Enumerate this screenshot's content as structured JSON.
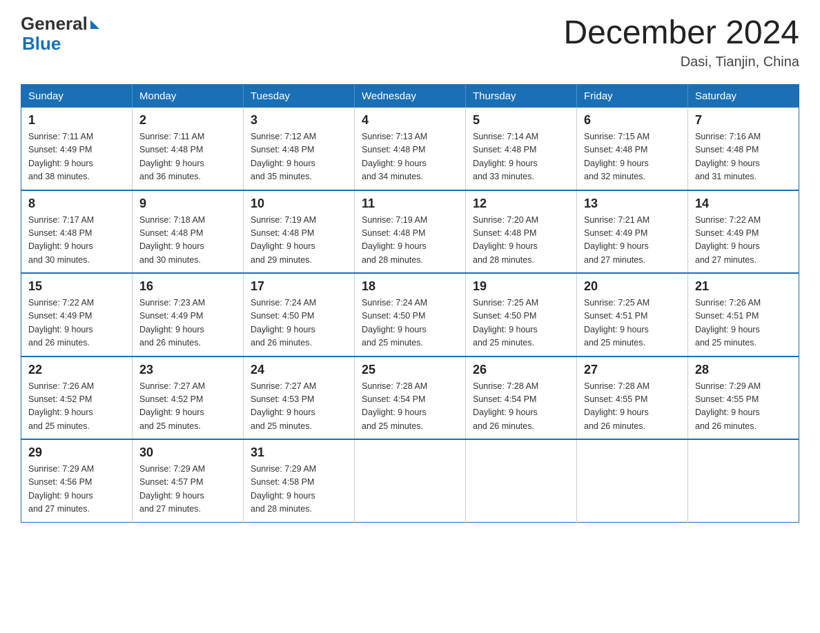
{
  "logo": {
    "text_general": "General",
    "text_blue": "Blue"
  },
  "title": "December 2024",
  "location": "Dasi, Tianjin, China",
  "days_of_week": [
    "Sunday",
    "Monday",
    "Tuesday",
    "Wednesday",
    "Thursday",
    "Friday",
    "Saturday"
  ],
  "weeks": [
    [
      {
        "day": "1",
        "sunrise": "7:11 AM",
        "sunset": "4:49 PM",
        "daylight": "9 hours and 38 minutes."
      },
      {
        "day": "2",
        "sunrise": "7:11 AM",
        "sunset": "4:48 PM",
        "daylight": "9 hours and 36 minutes."
      },
      {
        "day": "3",
        "sunrise": "7:12 AM",
        "sunset": "4:48 PM",
        "daylight": "9 hours and 35 minutes."
      },
      {
        "day": "4",
        "sunrise": "7:13 AM",
        "sunset": "4:48 PM",
        "daylight": "9 hours and 34 minutes."
      },
      {
        "day": "5",
        "sunrise": "7:14 AM",
        "sunset": "4:48 PM",
        "daylight": "9 hours and 33 minutes."
      },
      {
        "day": "6",
        "sunrise": "7:15 AM",
        "sunset": "4:48 PM",
        "daylight": "9 hours and 32 minutes."
      },
      {
        "day": "7",
        "sunrise": "7:16 AM",
        "sunset": "4:48 PM",
        "daylight": "9 hours and 31 minutes."
      }
    ],
    [
      {
        "day": "8",
        "sunrise": "7:17 AM",
        "sunset": "4:48 PM",
        "daylight": "9 hours and 30 minutes."
      },
      {
        "day": "9",
        "sunrise": "7:18 AM",
        "sunset": "4:48 PM",
        "daylight": "9 hours and 30 minutes."
      },
      {
        "day": "10",
        "sunrise": "7:19 AM",
        "sunset": "4:48 PM",
        "daylight": "9 hours and 29 minutes."
      },
      {
        "day": "11",
        "sunrise": "7:19 AM",
        "sunset": "4:48 PM",
        "daylight": "9 hours and 28 minutes."
      },
      {
        "day": "12",
        "sunrise": "7:20 AM",
        "sunset": "4:48 PM",
        "daylight": "9 hours and 28 minutes."
      },
      {
        "day": "13",
        "sunrise": "7:21 AM",
        "sunset": "4:49 PM",
        "daylight": "9 hours and 27 minutes."
      },
      {
        "day": "14",
        "sunrise": "7:22 AM",
        "sunset": "4:49 PM",
        "daylight": "9 hours and 27 minutes."
      }
    ],
    [
      {
        "day": "15",
        "sunrise": "7:22 AM",
        "sunset": "4:49 PM",
        "daylight": "9 hours and 26 minutes."
      },
      {
        "day": "16",
        "sunrise": "7:23 AM",
        "sunset": "4:49 PM",
        "daylight": "9 hours and 26 minutes."
      },
      {
        "day": "17",
        "sunrise": "7:24 AM",
        "sunset": "4:50 PM",
        "daylight": "9 hours and 26 minutes."
      },
      {
        "day": "18",
        "sunrise": "7:24 AM",
        "sunset": "4:50 PM",
        "daylight": "9 hours and 25 minutes."
      },
      {
        "day": "19",
        "sunrise": "7:25 AM",
        "sunset": "4:50 PM",
        "daylight": "9 hours and 25 minutes."
      },
      {
        "day": "20",
        "sunrise": "7:25 AM",
        "sunset": "4:51 PM",
        "daylight": "9 hours and 25 minutes."
      },
      {
        "day": "21",
        "sunrise": "7:26 AM",
        "sunset": "4:51 PM",
        "daylight": "9 hours and 25 minutes."
      }
    ],
    [
      {
        "day": "22",
        "sunrise": "7:26 AM",
        "sunset": "4:52 PM",
        "daylight": "9 hours and 25 minutes."
      },
      {
        "day": "23",
        "sunrise": "7:27 AM",
        "sunset": "4:52 PM",
        "daylight": "9 hours and 25 minutes."
      },
      {
        "day": "24",
        "sunrise": "7:27 AM",
        "sunset": "4:53 PM",
        "daylight": "9 hours and 25 minutes."
      },
      {
        "day": "25",
        "sunrise": "7:28 AM",
        "sunset": "4:54 PM",
        "daylight": "9 hours and 25 minutes."
      },
      {
        "day": "26",
        "sunrise": "7:28 AM",
        "sunset": "4:54 PM",
        "daylight": "9 hours and 26 minutes."
      },
      {
        "day": "27",
        "sunrise": "7:28 AM",
        "sunset": "4:55 PM",
        "daylight": "9 hours and 26 minutes."
      },
      {
        "day": "28",
        "sunrise": "7:29 AM",
        "sunset": "4:55 PM",
        "daylight": "9 hours and 26 minutes."
      }
    ],
    [
      {
        "day": "29",
        "sunrise": "7:29 AM",
        "sunset": "4:56 PM",
        "daylight": "9 hours and 27 minutes."
      },
      {
        "day": "30",
        "sunrise": "7:29 AM",
        "sunset": "4:57 PM",
        "daylight": "9 hours and 27 minutes."
      },
      {
        "day": "31",
        "sunrise": "7:29 AM",
        "sunset": "4:58 PM",
        "daylight": "9 hours and 28 minutes."
      },
      null,
      null,
      null,
      null
    ]
  ]
}
